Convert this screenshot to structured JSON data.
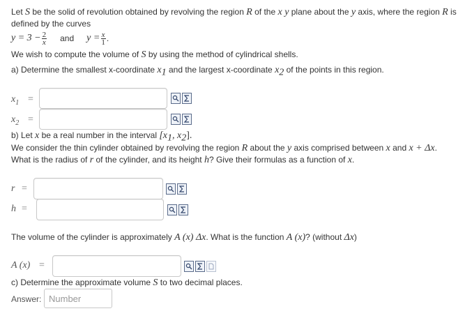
{
  "intro": {
    "line1_a": "Let ",
    "line1_S": "S",
    "line1_b": " be the solid of revolution obtained by revolving the region ",
    "line1_R": "R",
    "line1_c": " of the ",
    "line1_xy": "x y",
    "line1_d": " plane about the ",
    "line1_y": "y",
    "line1_e": " axis, where the region ",
    "line1_R2": "R",
    "line1_f": " is",
    "line2": "defined by the curves",
    "curve1_lhs": "y = 3 −",
    "curve1_num": "2",
    "curve1_den": "x",
    "and": "and",
    "curve2_lhs": "y =",
    "curve2_num": "x",
    "curve2_den": "1",
    "curve2_dot": ".",
    "line4_a": "We wish to compute the volume of ",
    "line4_S": "S",
    "line4_b": " by using the method of cylindrical shells."
  },
  "part_a": {
    "q_a": "a) Determine the smallest x-coordinate ",
    "q_x1": "x",
    "q_x1_sub": "1",
    "q_b": " and the largest x-coordinate ",
    "q_x2": "x",
    "q_x2_sub": "2",
    "q_c": " of the points in this region.",
    "x1_label": "x",
    "x1_sub": "1",
    "x2_label": "x",
    "x2_sub": "2",
    "eq": "="
  },
  "part_b": {
    "q1_a": "b) Let ",
    "q1_x": "x",
    "q1_b": " be a real number in the interval ",
    "q1_interval": "[x",
    "q1_s1": "1",
    "q1_mid": ", x",
    "q1_s2": "2",
    "q1_end": "].",
    "q2_a": "We consider the thin cylinder obtained by revolving the region ",
    "q2_R": "R",
    "q2_b": " about the ",
    "q2_y": "y",
    "q2_c": " axis comprised between ",
    "q2_x": "x",
    "q2_d": " and ",
    "q2_expr": "x + Δx",
    "q2_e": ".",
    "q3_a": "What is the radius of ",
    "q3_r": "r",
    "q3_b": " of the cylinder, and its height ",
    "q3_h": "h",
    "q3_c": "? Give their formulas as a function of ",
    "q3_x": "x",
    "q3_d": ".",
    "r_label": "r",
    "h_label": "h",
    "eq": "="
  },
  "volume": {
    "q_a": "The volume of the cylinder is approximately ",
    "q_A": "A (x)  Δx",
    "q_b": ". What is the function ",
    "q_A2": "A (x)",
    "q_c": "? (without ",
    "q_dx": "Δx",
    "q_d": ")",
    "A_label": "A (x)",
    "eq": "="
  },
  "part_c": {
    "q": "c) Determine the approximate volume ",
    "q_S": "S",
    "q_b": " to two decimal places.",
    "answer_label": "Answer:",
    "answer_placeholder": "Number"
  }
}
